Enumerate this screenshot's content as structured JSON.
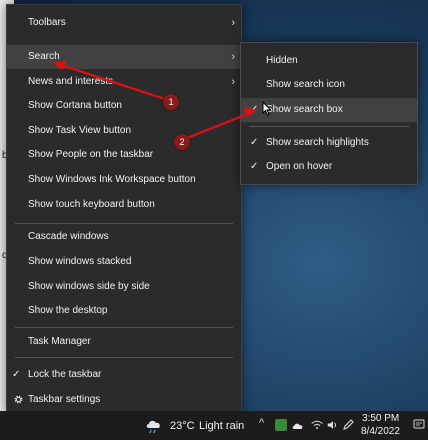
{
  "context_menu": {
    "items": [
      {
        "label": "Toolbars",
        "submenu": true
      },
      {
        "label": "Search",
        "submenu": true,
        "highlighted": true
      },
      {
        "label": "News and interests",
        "submenu": true
      },
      {
        "label": "Show Cortana button"
      },
      {
        "label": "Show Task View button"
      },
      {
        "label": "Show People on the taskbar"
      },
      {
        "label": "Show Windows Ink Workspace button"
      },
      {
        "label": "Show touch keyboard button"
      },
      {
        "label": "Cascade windows"
      },
      {
        "label": "Show windows stacked"
      },
      {
        "label": "Show windows side by side"
      },
      {
        "label": "Show the desktop"
      },
      {
        "label": "Task Manager"
      },
      {
        "label": "Lock the taskbar",
        "checked": true
      },
      {
        "label": "Taskbar settings",
        "icon": "gear-icon"
      }
    ]
  },
  "search_submenu": {
    "items": [
      {
        "label": "Hidden"
      },
      {
        "label": "Show search icon"
      },
      {
        "label": "Show search box",
        "checked": true,
        "highlighted": true
      },
      {
        "label": "Show search highlights",
        "checked": true
      },
      {
        "label": "Open on hover",
        "checked": true
      }
    ]
  },
  "taskbar": {
    "weather": {
      "temp": "23°C",
      "condition": "Light rain",
      "icon": "cloud-rain-icon"
    },
    "time": "3:50 PM",
    "date": "8/4/2022",
    "tray_icons": [
      "chevron-up-icon",
      "green-app-icon",
      "onedrive-icon",
      "wifi-icon",
      "volume-icon",
      "pen-icon",
      "notification-icon"
    ]
  },
  "annotations": {
    "badges": [
      "1",
      "2"
    ],
    "arrow_color": "#e01010"
  },
  "left_strip_labels": [
    "b",
    "d"
  ],
  "colors": {
    "menu_bg": "#2b2b2b",
    "highlight_bg": "#414141",
    "badge_bg": "#8b1a1a"
  }
}
